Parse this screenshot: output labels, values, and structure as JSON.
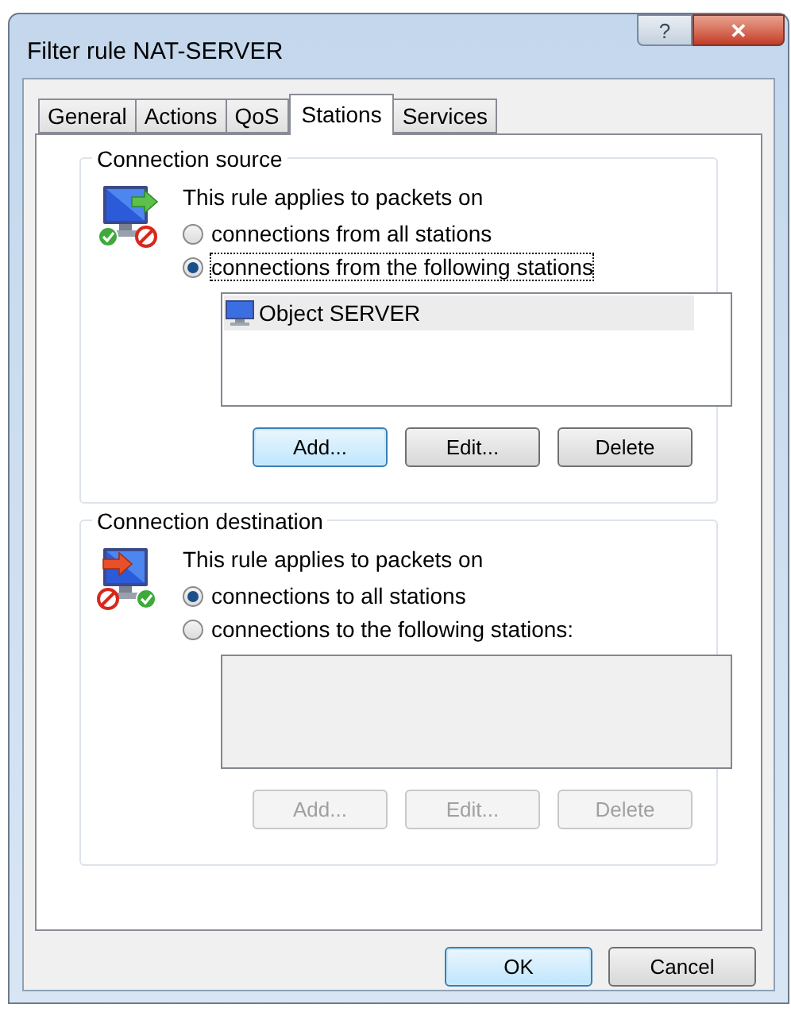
{
  "window": {
    "title": "Filter rule NAT-SERVER",
    "help_button": "?",
    "close_button": "✕"
  },
  "tabs": [
    {
      "label": "General",
      "selected": false
    },
    {
      "label": "Actions",
      "selected": false
    },
    {
      "label": "QoS",
      "selected": false
    },
    {
      "label": "Stations",
      "selected": true
    },
    {
      "label": "Services",
      "selected": false
    }
  ],
  "groups": [
    {
      "title": "Connection source",
      "kind": "source",
      "prompt": "This rule applies to packets on",
      "options": [
        {
          "label": "connections from all stations",
          "selected": false,
          "focused": false
        },
        {
          "label": "connections from the following stations",
          "selected": true,
          "focused": true
        }
      ],
      "list": {
        "disabled": false,
        "items": [
          {
            "label": "Object SERVER",
            "selected": true
          }
        ]
      },
      "buttons": [
        {
          "label": "Add...",
          "disabled": false,
          "default": true
        },
        {
          "label": "Edit...",
          "disabled": false,
          "default": false
        },
        {
          "label": "Delete",
          "disabled": false,
          "default": false
        }
      ]
    },
    {
      "title": "Connection destination",
      "kind": "destination",
      "prompt": "This rule applies to packets on",
      "options": [
        {
          "label": "connections to all stations",
          "selected": true,
          "focused": false
        },
        {
          "label": "connections to the following stations:",
          "selected": false,
          "focused": false
        }
      ],
      "list": {
        "disabled": true
      },
      "buttons": [
        {
          "label": "Add...",
          "disabled": true,
          "default": false
        },
        {
          "label": "Edit...",
          "disabled": true,
          "default": false
        },
        {
          "label": "Delete",
          "disabled": true,
          "default": false
        }
      ]
    }
  ],
  "footer_buttons": [
    {
      "label": "OK",
      "default": true
    },
    {
      "label": "Cancel",
      "default": false
    }
  ]
}
